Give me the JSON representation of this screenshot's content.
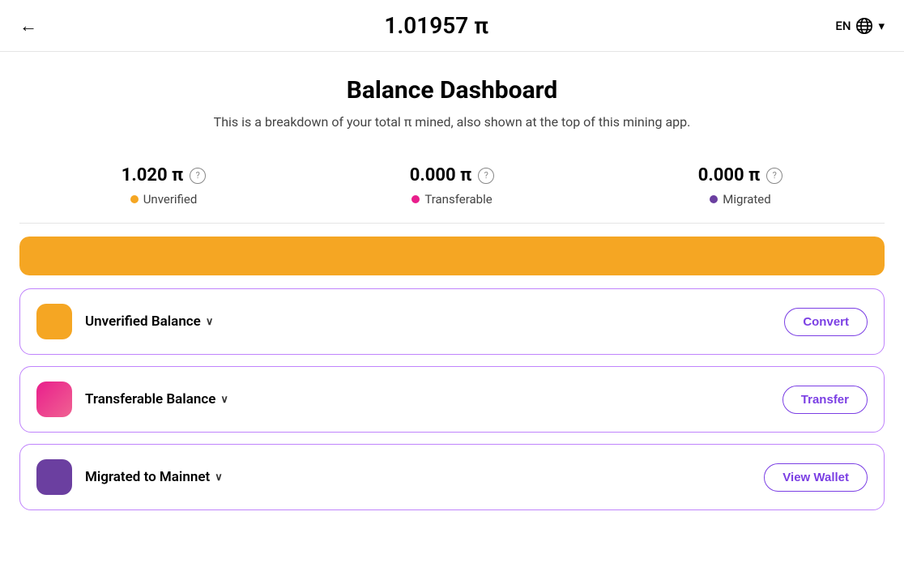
{
  "header": {
    "back_label": "←",
    "balance_integer": "1.",
    "balance_decimal": "01957",
    "pi_symbol": "π",
    "lang": "EN",
    "globe_icon": "globe-icon",
    "chevron_down": "▾"
  },
  "dashboard": {
    "title": "Balance Dashboard",
    "subtitle": "This is a breakdown of your total π mined, also shown at the top of this mining app."
  },
  "stats": [
    {
      "value": "1.020 π",
      "help": "?",
      "dot_color": "dot-orange",
      "label": "Unverified"
    },
    {
      "value": "0.000 π",
      "help": "?",
      "dot_color": "dot-pink",
      "label": "Transferable"
    },
    {
      "value": "0.000 π",
      "help": "?",
      "dot_color": "dot-purple",
      "label": "Migrated"
    }
  ],
  "balance_cards": [
    {
      "icon_class": "card-icon-orange",
      "title": "Unverified Balance",
      "button_label": "Convert"
    },
    {
      "icon_class": "card-icon-pink",
      "title": "Transferable Balance",
      "button_label": "Transfer"
    },
    {
      "icon_class": "card-icon-purple",
      "title": "Migrated to Mainnet",
      "button_label": "View Wallet"
    }
  ]
}
